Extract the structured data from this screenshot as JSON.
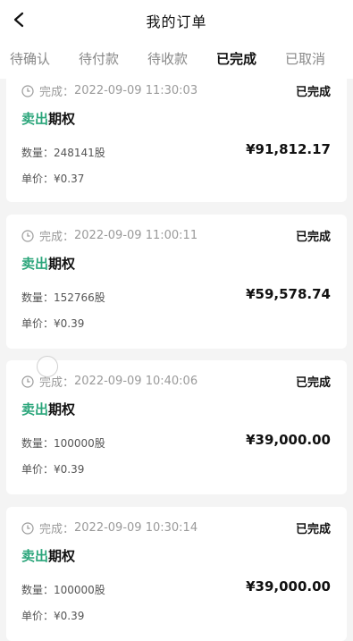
{
  "header": {
    "title": "我的订单"
  },
  "tabs": [
    "待确认",
    "待付款",
    "待收款",
    "已完成",
    "已取消"
  ],
  "orders": [
    {
      "time_prefix": "完成：",
      "time": "2022-09-09 11:30:03",
      "status": "已完成",
      "sell": "卖出",
      "product": "期权",
      "qty": "数量：248141股",
      "amount": "¥91,812.17",
      "price": "单价：¥0.37"
    },
    {
      "time_prefix": "完成：",
      "time": "2022-09-09 11:00:11",
      "status": "已完成",
      "sell": "卖出",
      "product": "期权",
      "qty": "数量：152766股",
      "amount": "¥59,578.74",
      "price": "单价：¥0.39"
    },
    {
      "time_prefix": "完成：",
      "time": "2022-09-09 10:40:06",
      "status": "已完成",
      "sell": "卖出",
      "product": "期权",
      "qty": "数量：100000股",
      "amount": "¥39,000.00",
      "price": "单价：¥0.39"
    },
    {
      "time_prefix": "完成：",
      "time": "2022-09-09 10:30:14",
      "status": "已完成",
      "sell": "卖出",
      "product": "期权",
      "qty": "数量：100000股",
      "amount": "¥39,000.00",
      "price": "单价：¥0.39"
    }
  ],
  "colors": {
    "accent": "#c0272d",
    "sell": "#2aa57a",
    "background": "#f4f4f4"
  }
}
